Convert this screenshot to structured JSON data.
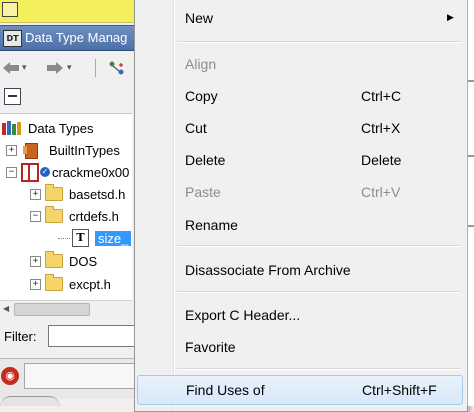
{
  "window": {
    "title": "Data Type Manag",
    "title_icon_text": "DT"
  },
  "toolbar": {
    "back_icon": "arrow-left-icon",
    "forward_icon": "arrow-right-icon",
    "dropdown_glyph": "▾",
    "refresh_icon": "sync-icon"
  },
  "tree": {
    "root_label": "Data Types",
    "nodes": [
      {
        "label": "BuiltInTypes",
        "expander": "+"
      },
      {
        "label": "crackme0x00",
        "expander": "−"
      },
      {
        "label": "basetsd.h",
        "expander": "+"
      },
      {
        "label": "crtdefs.h",
        "expander": "−"
      },
      {
        "label": "size_",
        "expander": ""
      },
      {
        "label": "DOS",
        "expander": "+"
      },
      {
        "label": "excpt.h",
        "expander": "+"
      }
    ],
    "typedef_glyph": "T"
  },
  "filter": {
    "label": "Filter:",
    "value": ""
  },
  "context_menu": {
    "items": [
      {
        "label": "New",
        "shortcut": "",
        "enabled": true,
        "submenu": true
      },
      {
        "label": "Align",
        "shortcut": "",
        "enabled": false
      },
      {
        "label": "Copy",
        "shortcut": "Ctrl+C",
        "enabled": true
      },
      {
        "label": "Cut",
        "shortcut": "Ctrl+X",
        "enabled": true
      },
      {
        "label": "Delete",
        "shortcut": "Delete",
        "enabled": true
      },
      {
        "label": "Paste",
        "shortcut": "Ctrl+V",
        "enabled": false
      },
      {
        "label": "Rename",
        "shortcut": "",
        "enabled": true
      },
      {
        "label": "Disassociate From Archive",
        "shortcut": "",
        "enabled": true
      },
      {
        "label": "Export C Header...",
        "shortcut": "",
        "enabled": true
      },
      {
        "label": "Favorite",
        "shortcut": "",
        "enabled": true
      },
      {
        "label": "Find Uses of",
        "shortcut": "Ctrl+Shift+F",
        "enabled": true,
        "highlighted": true
      }
    ],
    "submenu_arrow": "▶"
  },
  "colors": {
    "selection": "#3399ff",
    "title_bar": "#5577ad",
    "menu_bg": "#f0f0f0",
    "disabled_text": "#8d8d8d"
  }
}
